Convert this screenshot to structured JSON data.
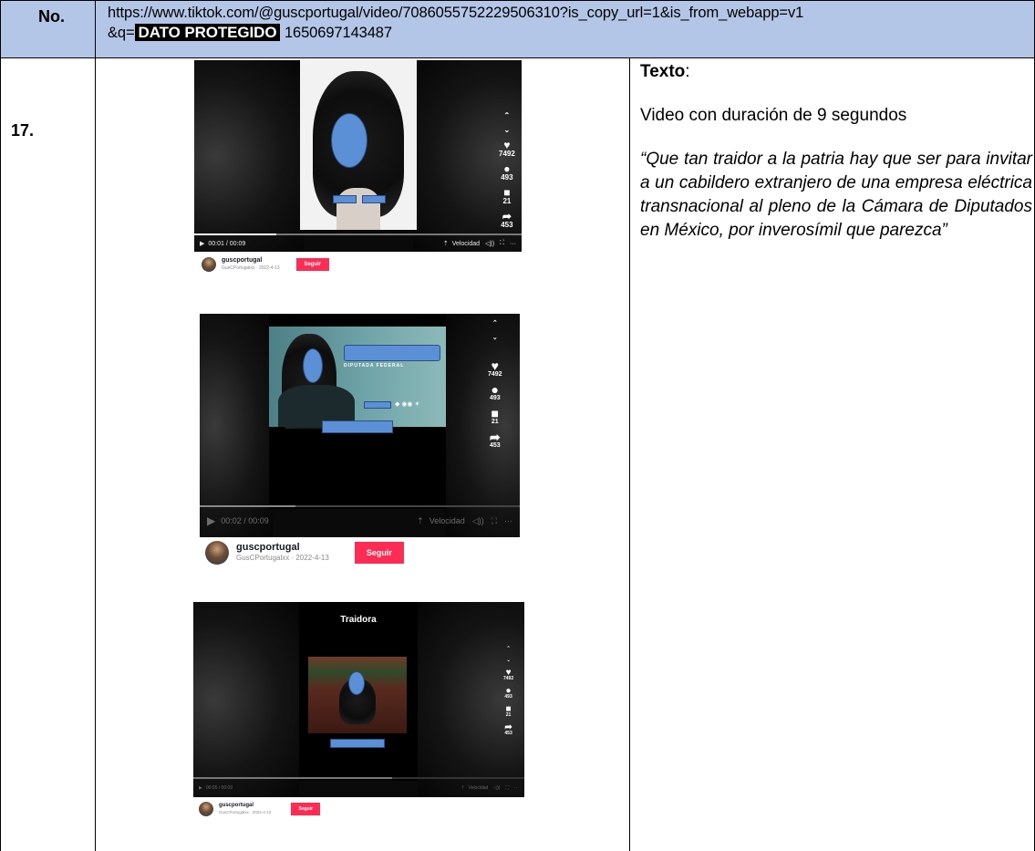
{
  "header": {
    "no_label": "No.",
    "url_line1": "https://www.tiktok.com/@guscportugal/video/7086055752229506310?is_copy_url=1&is_from_webapp=v1",
    "url_prefix": "&q=",
    "redacted": "DATO PROTEGIDO",
    "url_suffix": "1650697143487"
  },
  "row": {
    "number": "17.",
    "text_label": "Texto",
    "text_colon": ":",
    "duration": "Video con duración de 9 segundos",
    "quote": "“Que tan traidor a la patria hay que ser para invitar a un cabildero extranjero de una empresa eléctrica transnacional al pleno de la Cámara de Diputados en México, por inverosímil que parezca”"
  },
  "screenshots": [
    {
      "time": "00:01 / 00:09",
      "speed": "Velocidad",
      "likes": "7492",
      "comments": "493",
      "saves": "21",
      "shares": "453",
      "username": "guscportugal",
      "sub": "GusCPortugalxx · 2022-4-13",
      "follow": "Seguir",
      "progress": 0.25
    },
    {
      "time": "00:02 / 00:09",
      "speed": "Velocidad",
      "likes": "7492",
      "comments": "493",
      "saves": "21",
      "shares": "453",
      "username": "guscportugal",
      "sub": "GusCPortugalxx · 2022-4-13",
      "follow": "Seguir",
      "banner": "DIPUTADA FEDERAL",
      "progress": 0.3
    },
    {
      "caption": "Traidora",
      "time": "00:05 / 00:09",
      "speed": "Velocidad",
      "likes": "7492",
      "comments": "493",
      "saves": "21",
      "shares": "453",
      "username": "guscportugal",
      "sub": "GusCPortugalxx · 2022-4-13",
      "follow": "Seguir",
      "progress": 0.6
    }
  ],
  "icons": [
    "heart-icon",
    "comment-icon",
    "bookmark-icon",
    "share-icon",
    "play-icon",
    "volume-icon",
    "fullscreen-icon",
    "more-icon",
    "chevron-up-icon",
    "chevron-down-icon"
  ],
  "colors": {
    "header_bg": "#b4c6e7",
    "follow": "#fe2c55",
    "redaction": "#5b8fd6"
  }
}
